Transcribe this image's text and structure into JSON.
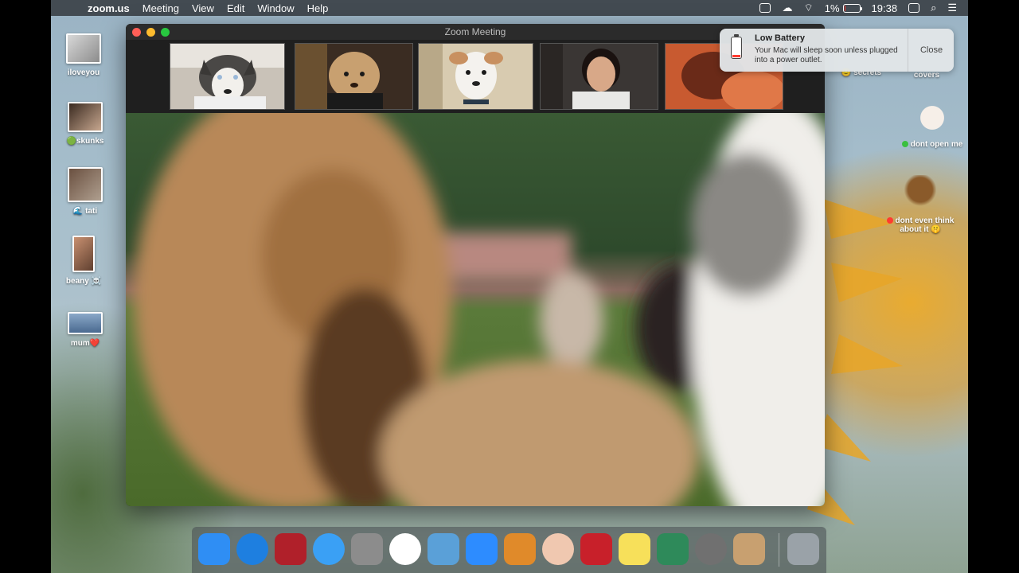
{
  "menubar": {
    "app": "zoom.us",
    "menus": [
      "Meeting",
      "View",
      "Edit",
      "Window",
      "Help"
    ],
    "battery_percent": "1%",
    "battery_level": 0.01,
    "time": "19:38"
  },
  "desktop_icons": [
    {
      "label": "iloveyou"
    },
    {
      "label": "skunks",
      "prefix": "🟢"
    },
    {
      "label": "tati",
      "prefix": "🌊"
    },
    {
      "label": "beany ☠️"
    },
    {
      "label": "mum❤️"
    },
    {
      "label": "secrets",
      "prefix": "🙂"
    },
    {
      "label": "covers"
    },
    {
      "label": "dont open me"
    },
    {
      "label": "dont even think about it 🤫"
    }
  ],
  "window": {
    "title": "Zoom Meeting"
  },
  "participants": [
    {
      "icon": "husky-video"
    },
    {
      "icon": "poodle-video"
    },
    {
      "icon": "terrier-video"
    },
    {
      "icon": "woman-video"
    },
    {
      "icon": "closeup-video"
    }
  ],
  "notification": {
    "title": "Low Battery",
    "body": "Your Mac will sleep soon unless plugged into a power outlet.",
    "close_label": "Close"
  },
  "dock": [
    {
      "icon": "finder-icon",
      "color": "#2f8ef4"
    },
    {
      "icon": "safari-icon",
      "color": "#1e7fe0"
    },
    {
      "icon": "photo-booth-icon",
      "color": "#b0202a"
    },
    {
      "icon": "messages-icon",
      "color": "#3aa0f5"
    },
    {
      "icon": "goat-app-icon",
      "color": "#8c8c8c"
    },
    {
      "icon": "itunes-icon",
      "color": "#ffffff"
    },
    {
      "icon": "seal-app-icon",
      "color": "#5aa0d8"
    },
    {
      "icon": "zoom-icon",
      "color": "#2d8cff"
    },
    {
      "icon": "garageband-icon",
      "color": "#e08a2a"
    },
    {
      "icon": "face-app-icon",
      "color": "#f0c8b0"
    },
    {
      "icon": "photo-app-icon",
      "color": "#c8202a"
    },
    {
      "icon": "stickies-icon",
      "color": "#f7e05a"
    },
    {
      "icon": "preview-icon",
      "color": "#2e8a5a"
    },
    {
      "icon": "system-preferences-icon",
      "color": "#707070"
    },
    {
      "icon": "contacts-icon",
      "color": "#c8a070"
    },
    {
      "icon": "trash-icon",
      "color": "#9aa2a8"
    }
  ]
}
